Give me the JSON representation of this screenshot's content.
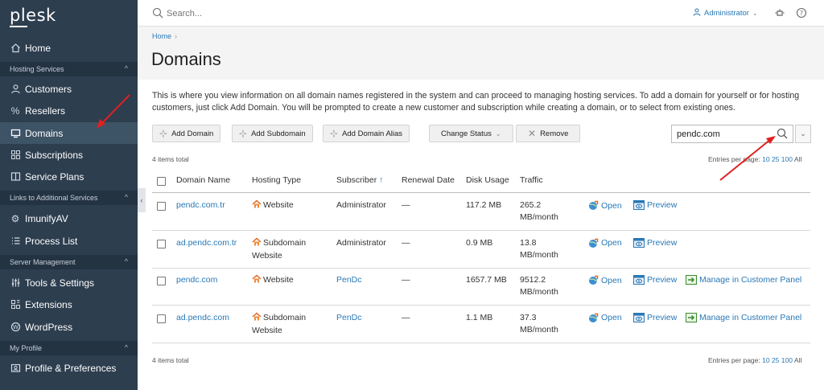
{
  "brand": {
    "logo": "plesk"
  },
  "sidebar": {
    "home": "Home",
    "sections": [
      {
        "title": "Hosting Services"
      },
      {
        "title": "Links to Additional Services"
      },
      {
        "title": "Server Management"
      },
      {
        "title": "My Profile"
      }
    ],
    "items": {
      "customers": "Customers",
      "resellers": "Resellers",
      "domains": "Domains",
      "subscriptions": "Subscriptions",
      "service_plans": "Service Plans",
      "imunifyav": "ImunifyAV",
      "process_list": "Process List",
      "tools_settings": "Tools & Settings",
      "extensions": "Extensions",
      "wordpress": "WordPress",
      "profile_prefs": "Profile & Preferences"
    },
    "active": "Domains"
  },
  "header": {
    "search_placeholder": "Search...",
    "user": "Administrator",
    "colors": {
      "accent": "#2978b5",
      "sidebar_bg": "#2d3e4f",
      "annotation_arrow": "#e02020"
    }
  },
  "page": {
    "breadcrumb": "Home",
    "title": "Domains",
    "description": "This is where you view information on all domain names registered in the system and can proceed to managing hosting services. To add a domain for yourself or for hosting customers, just click Add Domain. You will be prompted to create a new customer and subscription while creating a domain, or to select from existing ones."
  },
  "toolbar": {
    "add_domain": "Add Domain",
    "add_subdomain": "Add Subdomain",
    "add_alias": "Add Domain Alias",
    "change_status": "Change Status",
    "remove": "Remove",
    "filter_value": "pendc.com"
  },
  "list": {
    "total_top": "4 items total",
    "total_bottom": "4 items total",
    "entries_label": "Entries per page:",
    "page_sizes": [
      "10",
      "25",
      "100",
      "All"
    ],
    "columns": {
      "domain": "Domain Name",
      "hosting": "Hosting Type",
      "subscriber": "Subscriber",
      "sort_arrow": "↑",
      "renewal": "Renewal Date",
      "disk": "Disk Usage",
      "traffic": "Traffic"
    },
    "rows": [
      {
        "domain": "pendc.com.tr",
        "hosting_1": "Website",
        "hosting_2": "",
        "subscriber": "Administrator",
        "renewal": "—",
        "disk": "117.2 MB",
        "traffic_1": "265.2",
        "traffic_2": "MB/month",
        "open": "Open",
        "preview": "Preview",
        "manage": ""
      },
      {
        "domain": "ad.pendc.com.tr",
        "hosting_1": "Subdomain",
        "hosting_2": "Website",
        "subscriber": "Administrator",
        "renewal": "—",
        "disk": "0.9 MB",
        "traffic_1": "13.8",
        "traffic_2": "MB/month",
        "open": "Open",
        "preview": "Preview",
        "manage": ""
      },
      {
        "domain": "pendc.com",
        "hosting_1": "Website",
        "hosting_2": "",
        "subscriber": "PenDc",
        "renewal": "—",
        "disk": "1657.7 MB",
        "traffic_1": "9512.2",
        "traffic_2": "MB/month",
        "open": "Open",
        "preview": "Preview",
        "manage": "Manage in Customer Panel"
      },
      {
        "domain": "ad.pendc.com",
        "hosting_1": "Subdomain",
        "hosting_2": "Website",
        "subscriber": "PenDc",
        "renewal": "—",
        "disk": "1.1 MB",
        "traffic_1": "37.3",
        "traffic_2": "MB/month",
        "open": "Open",
        "preview": "Preview",
        "manage": "Manage in Customer Panel"
      }
    ]
  }
}
